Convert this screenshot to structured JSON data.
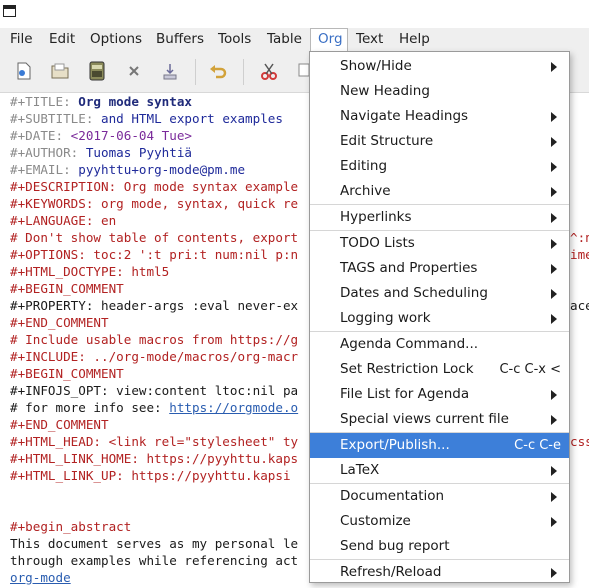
{
  "menubar": {
    "items": [
      {
        "label": "File"
      },
      {
        "label": "Edit"
      },
      {
        "label": "Options"
      },
      {
        "label": "Buffers"
      },
      {
        "label": "Tools"
      },
      {
        "label": "Table"
      },
      {
        "label": "Org"
      },
      {
        "label": "Text"
      },
      {
        "label": "Help"
      }
    ]
  },
  "toolbar": {
    "icons": [
      "new-file-icon",
      "open-folder-icon",
      "save-icon",
      "close-icon",
      "disk-icon",
      "undo-icon",
      "cut-icon",
      "copy-icon"
    ]
  },
  "editor": {
    "lines": [
      {
        "kw": "#+TITLE: ",
        "val": "Org mode syntax"
      },
      {
        "kw": "#+SUBTITLE: ",
        "val": "and HTML export examples"
      },
      {
        "kw": "#+DATE: ",
        "val": "<2017-06-04 Tue>"
      },
      {
        "kw": "#+AUTHOR: ",
        "val": "Tuomas Pyyhtiä"
      },
      {
        "kw": "#+EMAIL: ",
        "val": "pyyhttu+org-mode@pm.me"
      },
      {
        "text": "#+DESCRIPTION: Org mode syntax example"
      },
      {
        "text": "#+KEYWORDS: org mode, syntax, quick re"
      },
      {
        "text": "#+LANGUAGE: en"
      },
      {
        "text": "# Don't show table of contents, export",
        "right": "^:n"
      },
      {
        "text": "#+OPTIONS: toc:2 ':t pri:t num:nil p:n",
        "right": "ime"
      },
      {
        "text": "#+HTML_DOCTYPE: html5"
      },
      {
        "text": "#+BEGIN_COMMENT"
      },
      {
        "text": "#+PROPERTY: header-args :eval never-ex",
        "right": "ace"
      },
      {
        "text": "#+END_COMMENT"
      },
      {
        "text": "# Include usable macros from https://g"
      },
      {
        "text": "#+INCLUDE: ../org-mode/macros/org-macr"
      },
      {
        "text": "#+BEGIN_COMMENT"
      },
      {
        "text": "#+INFOJS_OPT: view:content ltoc:nil pa"
      },
      {
        "text": "# for more info see: ",
        "link": "https://orgmode.o"
      },
      {
        "text": "#+END_COMMENT"
      },
      {
        "text": "#+HTML_HEAD: <link rel=\"stylesheet\" ty",
        "right": "css"
      },
      {
        "text": "#+HTML_LINK_HOME: https://pyyhttu.kaps"
      },
      {
        "text": "#+HTML_LINK_UP: https://pyyhttu.kapsi"
      },
      {
        "text": ""
      },
      {
        "text": ""
      },
      {
        "text": "#+begin_abstract"
      },
      {
        "text": "This document serves as my personal le"
      },
      {
        "text": "through examples while referencing act"
      },
      {
        "link": "org-mode"
      }
    ]
  },
  "org_menu": {
    "items": [
      {
        "label": "Show/Hide",
        "submenu": true
      },
      {
        "label": "New Heading"
      },
      {
        "label": "Navigate Headings",
        "submenu": true
      },
      {
        "label": "Edit Structure",
        "submenu": true
      },
      {
        "label": "Editing",
        "submenu": true
      },
      {
        "label": "Archive",
        "submenu": true
      },
      {
        "label": "Hyperlinks",
        "submenu": true
      },
      {
        "label": "TODO Lists",
        "submenu": true
      },
      {
        "label": "TAGS and Properties",
        "submenu": true
      },
      {
        "label": "Dates and Scheduling",
        "submenu": true
      },
      {
        "label": "Logging work",
        "submenu": true
      },
      {
        "label": "Agenda Command..."
      },
      {
        "label": "Set Restriction Lock",
        "shortcut": "C-c C-x <"
      },
      {
        "label": "File List for Agenda",
        "submenu": true
      },
      {
        "label": "Special views current file",
        "submenu": true
      },
      {
        "label": "Export/Publish...",
        "shortcut": "C-c C-e",
        "highlighted": true
      },
      {
        "label": "LaTeX",
        "submenu": true
      },
      {
        "label": "Documentation",
        "submenu": true
      },
      {
        "label": "Customize",
        "submenu": true
      },
      {
        "label": "Send bug report"
      },
      {
        "label": "Refresh/Reload",
        "submenu": true
      }
    ]
  },
  "colors": {
    "highlight": "#3d7fd9",
    "keyword": "#b22222",
    "menu_active": "#3a6fc4"
  }
}
